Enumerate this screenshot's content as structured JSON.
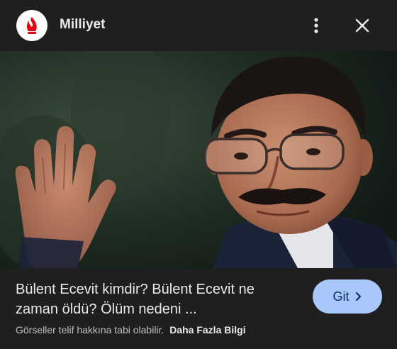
{
  "header": {
    "source_name": "Milliyet",
    "logo_icon": "milliyet-flame-logo",
    "more_icon": "more-vert-icon",
    "close_icon": "close-icon"
  },
  "image": {
    "lens_icon": "google-lens-icon"
  },
  "caption": {
    "title": "Bülent Ecevit kimdir? Bülent Ecevit ne zaman öldü? Ölüm nedeni ...",
    "visit_label": "Git",
    "visit_icon": "chevron-right-icon",
    "copyright_notice": "Görseller telif hakkına tabi olabilir.",
    "more_info_label": "Daha Fazla Bilgi"
  },
  "colors": {
    "background": "#1f1f1f",
    "visit_button": "#a8c7fa",
    "visit_text": "#062e6f",
    "logo_red": "#e30a17"
  }
}
